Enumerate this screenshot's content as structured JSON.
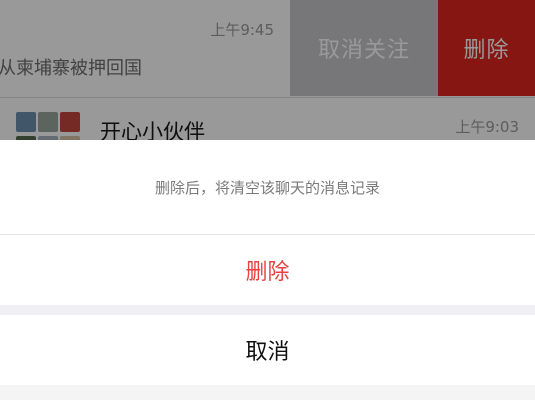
{
  "chat_list": {
    "row1": {
      "time": "上午9:45",
      "message": "从柬埔寨被押回国",
      "swipe_actions": {
        "unfollow_label": "取消关注",
        "delete_label": "删除",
        "unfollow_color": "#c7c7cc",
        "delete_color": "#e0261f"
      }
    },
    "row2": {
      "name": "开心小伙伴",
      "time": "上午9:03",
      "avatar_tiles": [
        "#6e8fb0",
        "#9aa7a1",
        "#c5473e",
        "#556b4f",
        "#a7b3bf",
        "#d9c3a5"
      ]
    }
  },
  "action_sheet": {
    "message": "删除后，将清空该聊天的消息记录",
    "delete_label": "删除",
    "cancel_label": "取消",
    "delete_color": "#e64340"
  }
}
